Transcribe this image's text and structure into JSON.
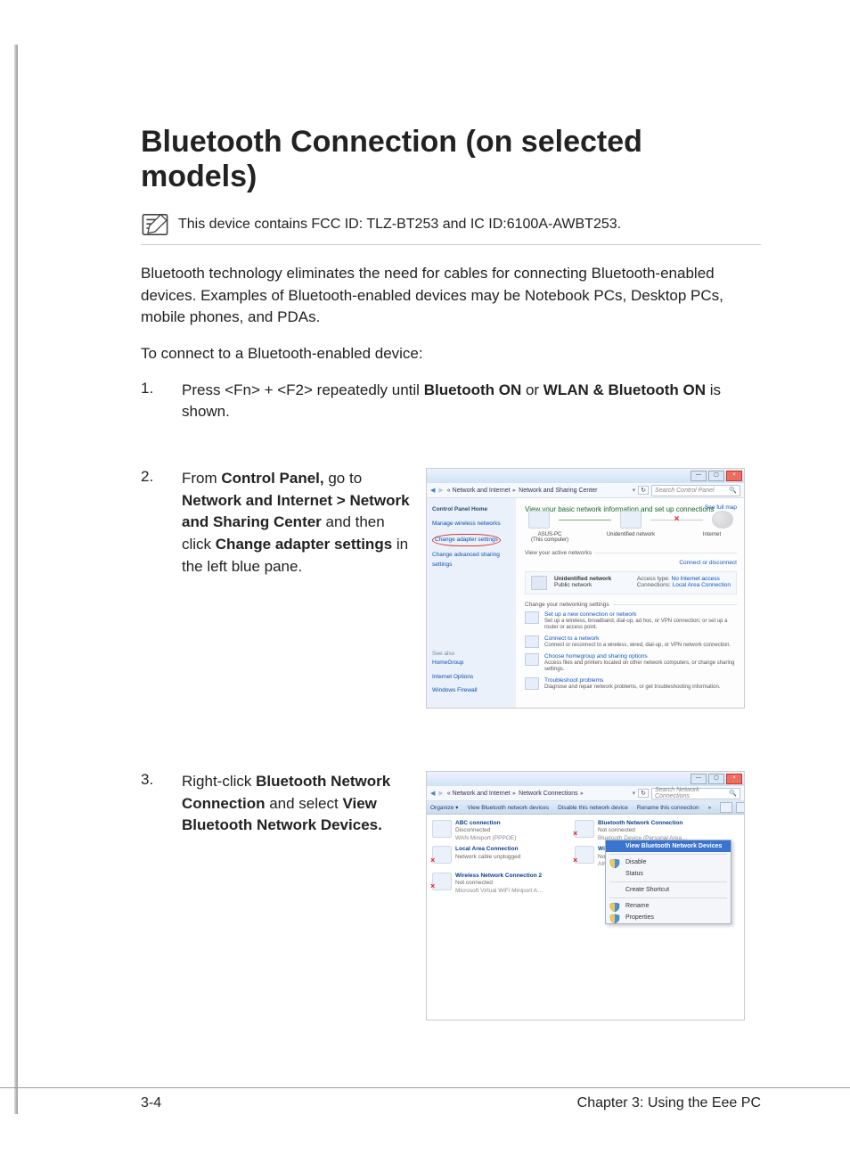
{
  "page": {
    "title": "Bluetooth Connection (on selected models)",
    "note": "This device contains FCC ID: TLZ-BT253 and IC ID:6100A-AWBT253.",
    "intro": "Bluetooth technology eliminates the need for cables for connecting Bluetooth-enabled devices. Examples of Bluetooth-enabled devices may be Notebook PCs, Desktop PCs, mobile phones, and PDAs.",
    "lead": "To connect to a Bluetooth-enabled device:",
    "footer_left": "3-4",
    "footer_right": "Chapter 3:  Using the Eee PC"
  },
  "steps": [
    {
      "n": "1.",
      "html": "Press <Fn> + <F2> repeatedly until <b>Bluetooth ON</b> or <b>WLAN & Bluetooth ON</b> is shown."
    },
    {
      "n": "2.",
      "html": "From <b>Control Panel,</b> go to <b>Network and Internet > Network and Sharing Center</b> and then click <b>Change adapter settings</b> in the left blue pane."
    },
    {
      "n": "3.",
      "html": "Right-click <b>Bluetooth Network Connection</b> and select <b>View Bluetooth Network Devices.</b>"
    }
  ],
  "shot1": {
    "crumbs": [
      "Network and Internet",
      "Network and Sharing Center"
    ],
    "search_placeholder": "Search Control Panel",
    "left": {
      "header": "Control Panel Home",
      "links": [
        "Manage wireless networks",
        "Change adapter settings",
        "Change advanced sharing settings"
      ],
      "see_also": "See also",
      "see_links": [
        "HomeGroup",
        "Internet Options",
        "Windows Firewall"
      ]
    },
    "main_header": "View your basic network information and set up connections",
    "see_full_map": "See full map",
    "diagram": {
      "pc": "ASUS-PC",
      "pc_sub": "(This computer)",
      "mid": "Unidentified network",
      "net": "Internet"
    },
    "view_active": "View your active networks",
    "connect_disconnect": "Connect or disconnect",
    "active": {
      "name": "Unidentified network",
      "type": "Public network",
      "access_label": "Access type:",
      "access_value": "No Internet access",
      "conn_label": "Connections:",
      "conn_value": "Local Area Connection"
    },
    "change_settings": "Change your networking settings",
    "opts": [
      {
        "title": "Set up a new connection or network",
        "sub": "Set up a wireless, broadband, dial-up, ad hoc, or VPN connection; or set up a router or access point."
      },
      {
        "title": "Connect to a network",
        "sub": "Connect or reconnect to a wireless, wired, dial-up, or VPN network connection."
      },
      {
        "title": "Choose homegroup and sharing options",
        "sub": "Access files and printers located on other network computers, or change sharing settings."
      },
      {
        "title": "Troubleshoot problems",
        "sub": "Diagnose and repair network problems, or get troubleshooting information."
      }
    ]
  },
  "shot2": {
    "crumbs": [
      "Network and Internet",
      "Network Connections"
    ],
    "search_placeholder": "Search Network Connections",
    "toolbar": [
      "Organize ▾",
      "View Bluetooth network devices",
      "Disable this network device",
      "Rename this connection",
      "»"
    ],
    "connections": [
      {
        "name": "ABC connection",
        "status": "Disconnected",
        "mini": "WAN Miniport (PPPOE)",
        "x": false
      },
      {
        "name": "Bluetooth Network Connection",
        "status": "Not connected",
        "mini": "Bluetooth Device (Personal Area…",
        "x": true
      },
      {
        "name": "Local Area Connection",
        "status": "Network cable unplugged",
        "mini": "",
        "x": true
      },
      {
        "name": "Wireless Network Connection",
        "status": "Not connected",
        "mini": "Atheros AR9285 Wireless Network…",
        "x": true
      },
      {
        "name": "Wireless Network Connection 2",
        "status": "Not connected",
        "mini": "Microsoft Virtual WiFi Miniport A…",
        "x": true
      }
    ],
    "menu": [
      "View Bluetooth Network Devices",
      "Disable",
      "Status",
      "Create Shortcut",
      "Rename",
      "Properties"
    ],
    "menu_highlight": 0
  }
}
